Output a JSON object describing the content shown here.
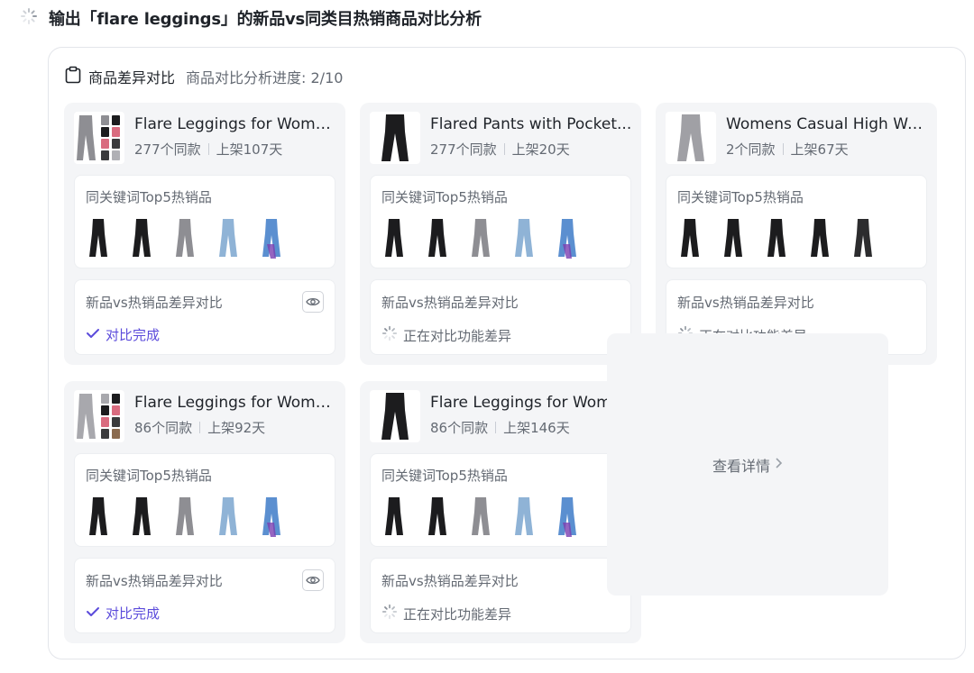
{
  "header": {
    "title": "输出「flare leggings」的新品vs同类目热销商品对比分析"
  },
  "panel": {
    "title": "商品差异对比",
    "progress": "商品对比分析进度: 2/10",
    "hot_label": "同关键词Top5热销品",
    "compare_label": "新品vs热销品差异对比",
    "more_label": "查看详情"
  },
  "cards": [
    {
      "title": "Flare Leggings for Wome...",
      "same_count": "277个同款",
      "listed": "上架107天",
      "status": "对比完成",
      "status_type": "done"
    },
    {
      "title": "Flared Pants with Pocket...",
      "same_count": "277个同款",
      "listed": "上架20天",
      "status": "正在对比功能差异",
      "status_type": "pending"
    },
    {
      "title": "Womens Casual High Wa...",
      "same_count": "2个同款",
      "listed": "上架67天",
      "status": "正在对比功能差异",
      "status_type": "pending"
    },
    {
      "title": "Flare Leggings for Wome...",
      "same_count": "86个同款",
      "listed": "上架92天",
      "status": "对比完成",
      "status_type": "done"
    },
    {
      "title": "Flare Leggings for Wome...",
      "same_count": "86个同款",
      "listed": "上架146天",
      "status": "正在对比功能差异",
      "status_type": "pending"
    }
  ],
  "colors": {
    "accent": "#5b4bdb",
    "muted_text": "#646a73",
    "card_bg": "#f4f5f7",
    "pant_black": "#1c1c1e",
    "pant_gray": "#8e8e93",
    "pant_lightblue": "#8fb3d6",
    "pant_blue": "#5b8fd0",
    "pant_purple": "#7b3fb0"
  },
  "icons": {
    "header": "loading-spinner-icon",
    "panel": "clipboard-icon",
    "view": "eye-icon",
    "done": "check-icon",
    "pending": "loading-spinner-icon",
    "more": "chevron-right-icon"
  }
}
